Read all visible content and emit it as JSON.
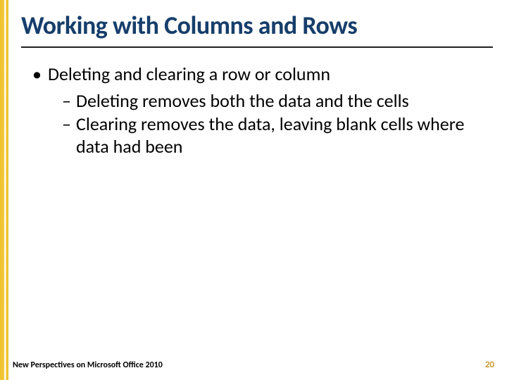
{
  "title": "Working with Columns and Rows",
  "bullets": {
    "lvl1_0": "Deleting and clearing a row or column",
    "lvl2_0": "Deleting removes both the data and the cells",
    "lvl2_1": "Clearing removes the data, leaving blank cells where data had been"
  },
  "footer": {
    "left": "New Perspectives on Microsoft Office 2010",
    "page": "20"
  }
}
